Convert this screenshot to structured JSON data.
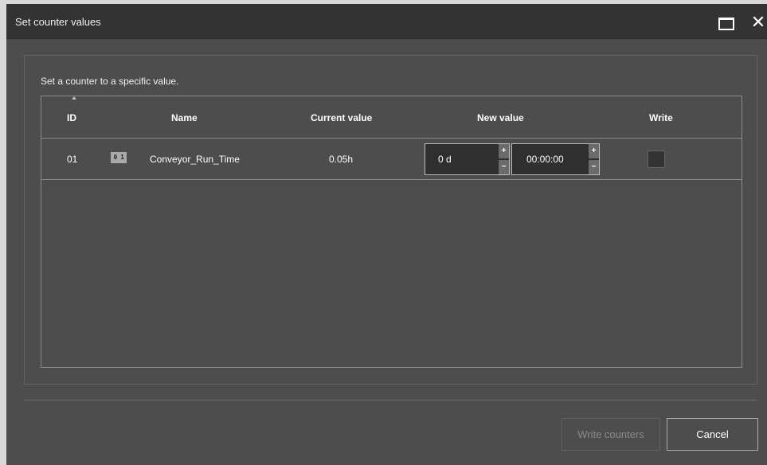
{
  "window": {
    "title": "Set counter values",
    "maximize_icon": "maximize-icon",
    "close_icon": "close-icon",
    "close_glyph": "✕"
  },
  "panel": {
    "description": "Set a counter to a specific value."
  },
  "table": {
    "headers": {
      "id": "ID",
      "name": "Name",
      "current": "Current value",
      "new": "New value",
      "write": "Write"
    },
    "sort_indicator": "ascending",
    "rows": [
      {
        "id": "01",
        "icon": "counter-icon",
        "icon_text": "0 1 ",
        "name": "Conveyor_Run_Time",
        "current_value": "0.05h",
        "new_days": "0 d",
        "new_time": "00:00:00",
        "spin_up": "+",
        "spin_down": "−",
        "write_checked": false
      }
    ]
  },
  "buttons": {
    "write_counters": "Write counters",
    "cancel": "Cancel"
  },
  "colors": {
    "background": "#4d4d4d",
    "titlebar": "#333333",
    "accent": "#f0a030"
  }
}
